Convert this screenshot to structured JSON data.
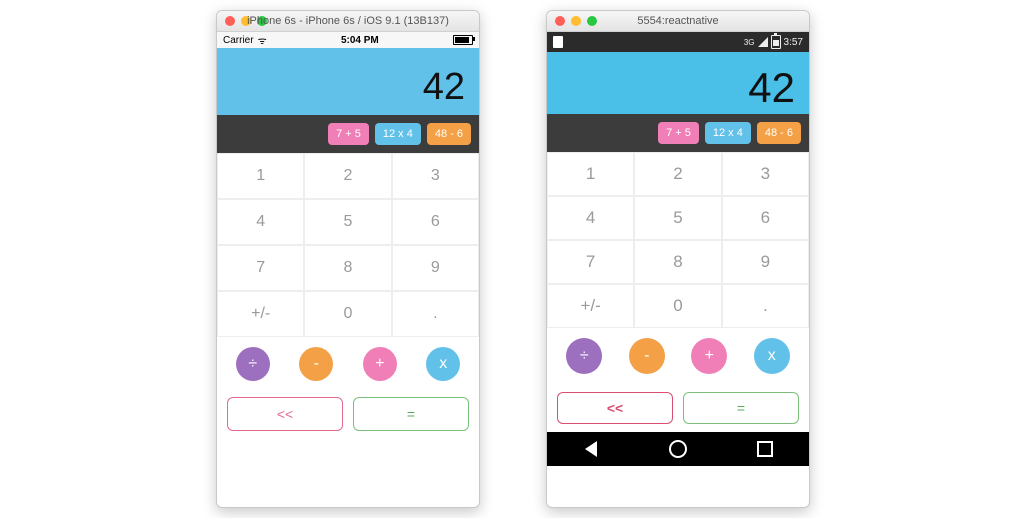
{
  "ios": {
    "window_title": "iPhone 6s - iPhone 6s / iOS 9.1 (13B137)",
    "status": {
      "carrier": "Carrier",
      "time": "5:04 PM"
    },
    "display": "42",
    "history": [
      {
        "label": "7 + 5",
        "color": "pink"
      },
      {
        "label": "12 x 4",
        "color": "blue"
      },
      {
        "label": "48 - 6",
        "color": "orange"
      }
    ],
    "keys": [
      [
        "1",
        "2",
        "3"
      ],
      [
        "4",
        "5",
        "6"
      ],
      [
        "7",
        "8",
        "9"
      ],
      [
        "+/-",
        "0",
        "."
      ]
    ],
    "ops": {
      "divide": "÷",
      "minus": "-",
      "plus": "+",
      "times": "x"
    },
    "bottom": {
      "del": "<<",
      "eq": "="
    }
  },
  "android": {
    "window_title": "5554:reactnative",
    "status": {
      "net": "3G",
      "time": "3:57"
    },
    "display": "42",
    "history": [
      {
        "label": "7 + 5",
        "color": "pink"
      },
      {
        "label": "12 x 4",
        "color": "blue"
      },
      {
        "label": "48 - 6",
        "color": "orange"
      }
    ],
    "keys": [
      [
        "1",
        "2",
        "3"
      ],
      [
        "4",
        "5",
        "6"
      ],
      [
        "7",
        "8",
        "9"
      ],
      [
        "+/-",
        "0",
        "."
      ]
    ],
    "ops": {
      "divide": "÷",
      "minus": "-",
      "plus": "+",
      "times": "x"
    },
    "bottom": {
      "del": "<<",
      "eq": "="
    }
  }
}
